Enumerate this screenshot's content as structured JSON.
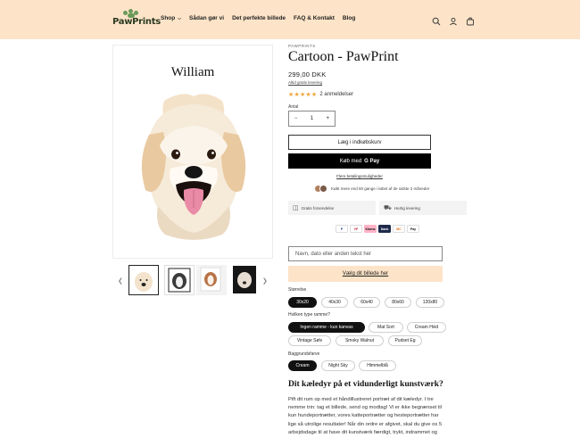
{
  "header": {
    "logo_text": "PawPrints",
    "nav": [
      {
        "label": "Shop",
        "has_dropdown": true
      },
      {
        "label": "Sådan gør vi",
        "has_dropdown": false
      },
      {
        "label": "Det perfekte billede",
        "has_dropdown": false
      },
      {
        "label": "FAQ & Kontakt",
        "has_dropdown": false
      },
      {
        "label": "Blog",
        "has_dropdown": false
      }
    ],
    "icons": [
      "search-icon",
      "account-icon",
      "cart-icon"
    ],
    "background": "#fde4c8"
  },
  "gallery": {
    "pet_name": "William",
    "thumbnail_count": 4,
    "active_thumbnail": 1
  },
  "product": {
    "brand": "PAWPRINTS",
    "title": "Cartoon - PawPrint",
    "price": "299,00 DKK",
    "shipping_link": "Altid gratis levering",
    "rating_stars": 5,
    "reviews": "2 anmeldelser",
    "quantity_label": "Antal",
    "quantity": "1",
    "qty_minus": "−",
    "qty_plus": "+",
    "add_to_cart": "Læg i indkøbskurv",
    "buy_with": "Køb med",
    "gpay": "G Pay",
    "more_payment": "Flere betalingsmuligheder",
    "social_proof": "Købt mere end 50 gange i løbet af de sidste 2 måneder",
    "features": [
      "Gratis forsendelse",
      "Hurtig levering"
    ],
    "payment_methods": [
      "P",
      "VP",
      "Klarna",
      "Dank",
      "MC",
      "Pay"
    ],
    "name_placeholder": "Navn, dato eller anden tekst her",
    "upload_label": "Vælg dit billede her"
  },
  "options": {
    "size": {
      "label": "Størrelse",
      "values": [
        "30x20",
        "40x30",
        "60x40",
        "80x60",
        "120x80"
      ],
      "selected": "30x20"
    },
    "frame": {
      "label": "Hvilken type ramme?",
      "values": [
        "Ingen ramme - kun kanvas",
        "Mat Sort",
        "Cream Hvid",
        "Vintage Sølv",
        "Smoky Walnut",
        "Pudset Eg"
      ],
      "selected": "Ingen ramme - kun kanvas"
    },
    "background": {
      "label": "Baggrundsfarve",
      "values": [
        "Cream",
        "Night Sky",
        "Himmelblå"
      ],
      "selected": "Cream"
    }
  },
  "description": {
    "title": "Dit kæledyr på et vidunderligt kunstværk?",
    "body": "Pift dit rum op med et håndillustreret portræt af dit kæledyr. I tre nemme trin: tag et billede, send og modtag! Vi er ikke begrænset til kun hundeportrætter, vores katteportrætter og hesteportrætter har lige så utrolige resultater! Når din ordre er afgivet, skal du give os 5 arbejdsdage til at have dit kunstværk færdigt, trykt, indrammet og"
  },
  "colors": {
    "accent": "#fde4c8",
    "star": "#f2a53a",
    "selected_chip": "#111111"
  }
}
